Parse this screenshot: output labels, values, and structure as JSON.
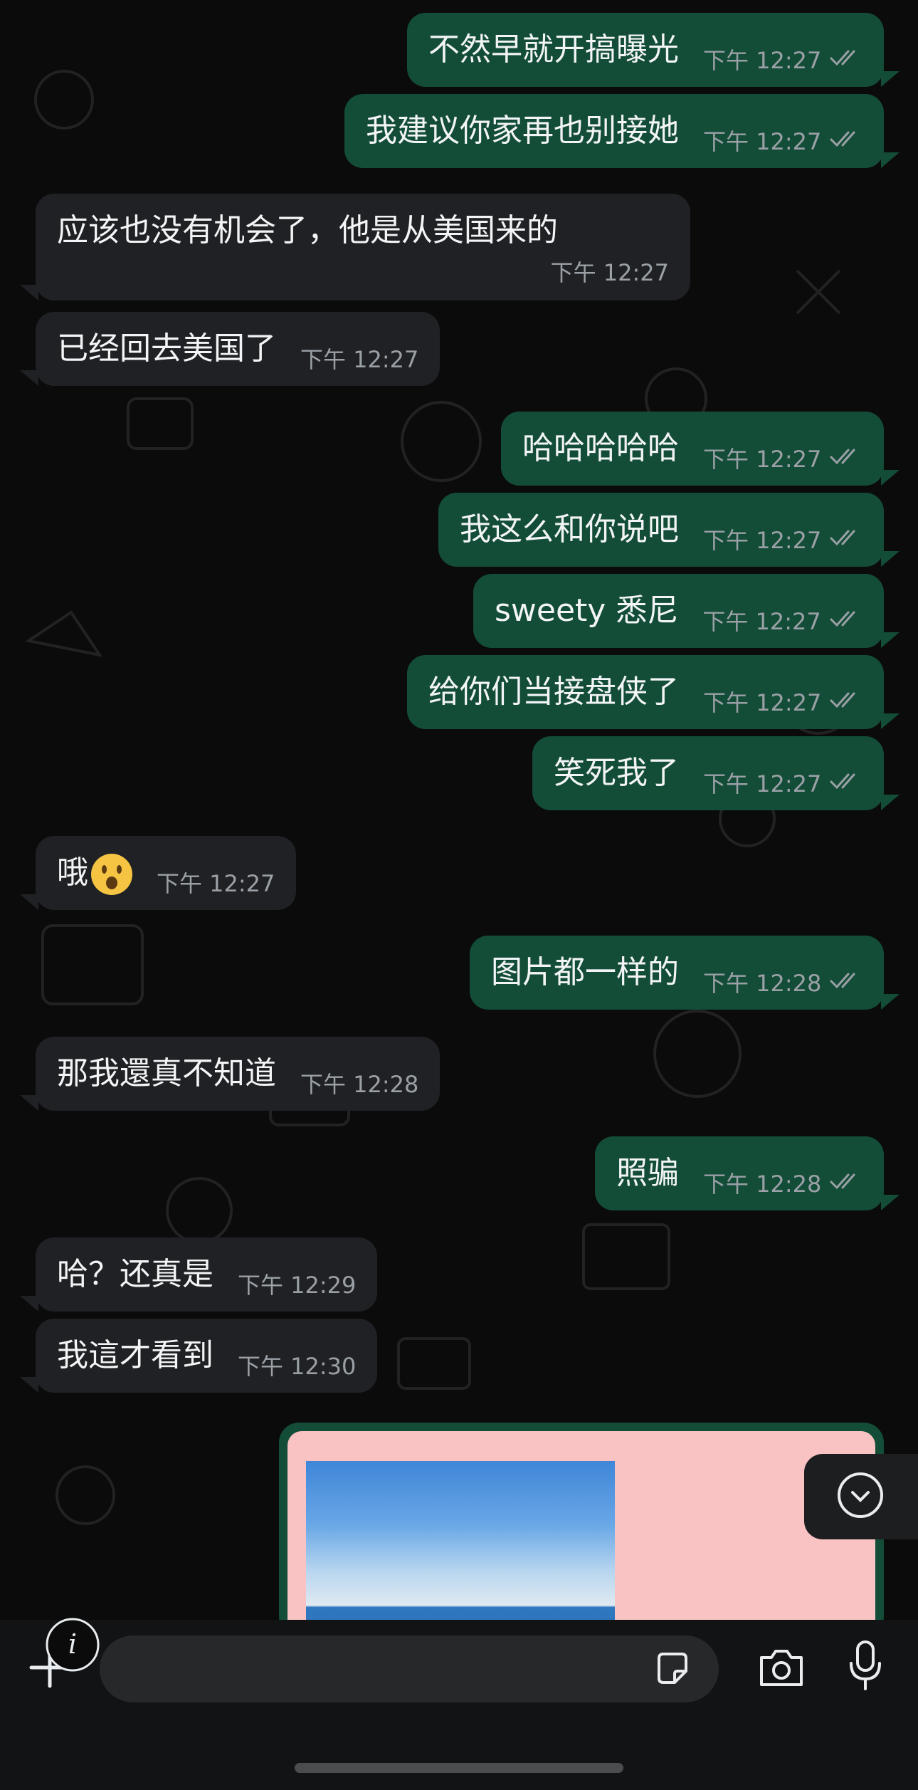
{
  "messages": [
    {
      "dir": "out",
      "text": "不然早就开搞曝光",
      "time": "下午 12:27",
      "read": true
    },
    {
      "dir": "out",
      "text": "我建议你家再也别接她",
      "time": "下午 12:27",
      "read": true
    },
    {
      "dir": "in",
      "text": "应该也没有机会了，他是从美国来的",
      "time": "下午 12:27"
    },
    {
      "dir": "in",
      "text": "已经回去美国了",
      "time": "下午 12:27"
    },
    {
      "dir": "out",
      "text": "哈哈哈哈哈",
      "time": "下午 12:27",
      "read": true
    },
    {
      "dir": "out",
      "text": "我这么和你说吧",
      "time": "下午 12:27",
      "read": true
    },
    {
      "dir": "out",
      "text": "sweety 悉尼",
      "time": "下午 12:27",
      "read": true
    },
    {
      "dir": "out",
      "text": "给你们当接盘侠了",
      "time": "下午 12:27",
      "read": true
    },
    {
      "dir": "out",
      "text": "笑死我了",
      "time": "下午 12:27",
      "read": true
    },
    {
      "dir": "in",
      "text": "哦",
      "emoji": "astonished-face",
      "time": "下午 12:27"
    },
    {
      "dir": "out",
      "text": "图片都一样的",
      "time": "下午 12:28",
      "read": true
    },
    {
      "dir": "in",
      "text": "那我還真不知道",
      "time": "下午 12:28"
    },
    {
      "dir": "out",
      "text": "照骗",
      "time": "下午 12:28",
      "read": true
    },
    {
      "dir": "in",
      "text": "哈？还真是",
      "time": "下午 12:29"
    },
    {
      "dir": "in",
      "text": "我這才看到",
      "time": "下午 12:30"
    }
  ],
  "attachment": {
    "type": "image",
    "icon": "image-thumbnail"
  },
  "input_bar": {
    "message_value": "",
    "icons": [
      "plus-icon",
      "info-icon",
      "sticker-icon",
      "camera-icon",
      "microphone-icon"
    ]
  },
  "colors": {
    "outgoing": "#134d37",
    "incoming": "#1f2124",
    "background": "#0b0b0b",
    "accent": "#25d366"
  }
}
